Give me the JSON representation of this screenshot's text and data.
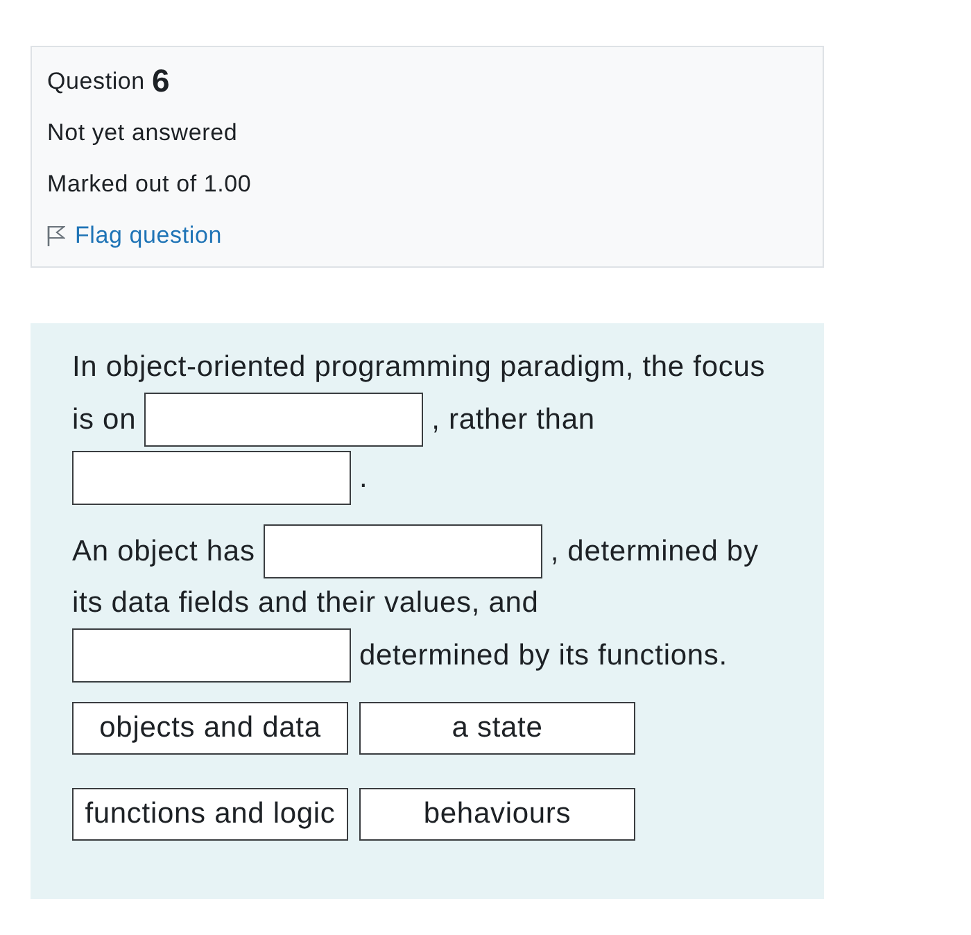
{
  "question_info": {
    "label": "Question",
    "number": "6",
    "status": "Not yet answered",
    "grade": "Marked out of 1.00",
    "flag": {
      "label": "Flag question",
      "flagged": false
    }
  },
  "question_text": {
    "paragraphs": [
      {
        "lines": [
          [
            {
              "kind": "text",
              "text": "In object-oriented programming paradigm, the focus"
            }
          ],
          [
            {
              "kind": "text",
              "text": "is on"
            },
            {
              "kind": "blank"
            },
            {
              "kind": "text",
              "text": ", rather than"
            }
          ],
          [
            {
              "kind": "blank"
            },
            {
              "kind": "text",
              "text": "."
            }
          ]
        ]
      },
      {
        "lines": [
          [
            {
              "kind": "text",
              "text": "An object has"
            },
            {
              "kind": "blank"
            },
            {
              "kind": "text",
              "text": ", determined by"
            }
          ],
          [
            {
              "kind": "text",
              "text": "its data fields and their values, and"
            }
          ],
          [
            {
              "kind": "blank"
            },
            {
              "kind": "text",
              "text": "determined by its functions."
            }
          ]
        ]
      }
    ]
  },
  "choices": [
    {
      "text": "objects and data"
    },
    {
      "text": "a state"
    },
    {
      "text": "functions and logic"
    },
    {
      "text": "behaviours"
    }
  ]
}
